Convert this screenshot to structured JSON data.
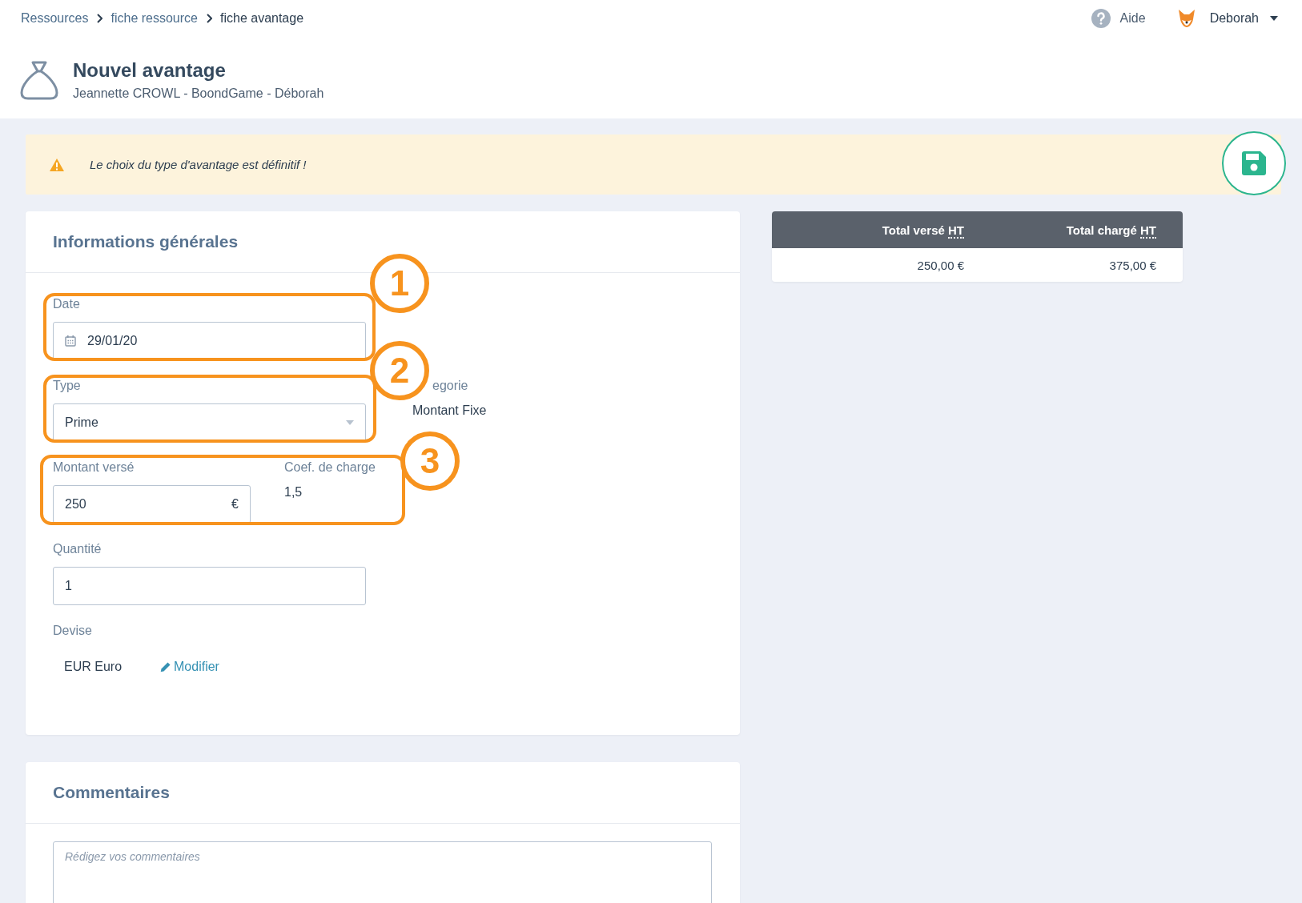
{
  "breadcrumb": [
    {
      "label": "Ressources",
      "link": true
    },
    {
      "label": "fiche ressource",
      "link": true
    },
    {
      "label": "fiche avantage",
      "link": false
    }
  ],
  "header_right": {
    "help": "Aide",
    "user": "Deborah"
  },
  "page": {
    "title": "Nouvel avantage",
    "subtitle": "Jeannette CROWL - BoondGame - Déborah"
  },
  "alert": {
    "message": "Le choix du type d'avantage est définitif !"
  },
  "general": {
    "title": "Informations générales",
    "date": {
      "label": "Date",
      "value": "29/01/20"
    },
    "type": {
      "label": "Type",
      "value": "Prime"
    },
    "category": {
      "label": "egorie",
      "value": "Montant Fixe"
    },
    "amount": {
      "label": "Montant versé",
      "value": "250",
      "unit": "€"
    },
    "coef": {
      "label": "Coef. de charge",
      "value": "1,5"
    },
    "quantity": {
      "label": "Quantité",
      "value": "1"
    },
    "currency": {
      "label": "Devise",
      "value": "EUR Euro",
      "action": "Modifier"
    }
  },
  "annotations": [
    "1",
    "2",
    "3"
  ],
  "totals": {
    "columns": [
      {
        "label": "Total versé",
        "abbr": "HT"
      },
      {
        "label": "Total chargé",
        "abbr": "HT"
      }
    ],
    "values": [
      "250,00 €",
      "375,00 €"
    ]
  },
  "comments": {
    "title": "Commentaires",
    "placeholder": "Rédigez vos commentaires"
  }
}
